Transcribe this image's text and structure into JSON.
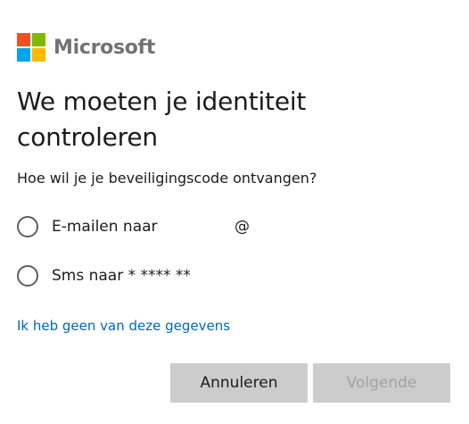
{
  "brand": {
    "name": "Microsoft",
    "logo_colors": [
      "#f25022",
      "#7fba00",
      "#00a4ef",
      "#ffb900"
    ]
  },
  "title": "We moeten je identiteit controleren",
  "question": "Hoe wil je je beveiligingscode ontvangen?",
  "options": [
    {
      "label": "E-mailen naar",
      "suffix": "@",
      "selected": false
    },
    {
      "label": "Sms naar * **** **",
      "selected": false
    }
  ],
  "link_text": "Ik heb geen van deze gegevens",
  "buttons": {
    "cancel_label": "Annuleren",
    "next_label": "Volgende",
    "next_enabled": false
  },
  "colors": {
    "accent_link": "#0067b8",
    "button_bg": "#cccccc",
    "disabled_text": "#a2a2a2"
  }
}
